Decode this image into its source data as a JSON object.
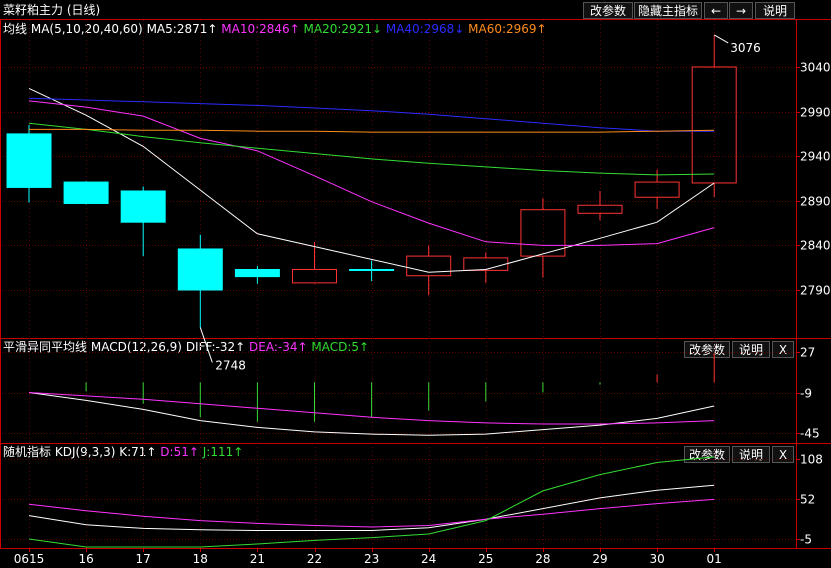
{
  "title_bar": {
    "name": "菜籽粕主力 (日线)",
    "buttons": [
      "改参数",
      "隐藏主指标",
      "←",
      "→",
      "说明"
    ]
  },
  "panels": {
    "ma": {
      "label": "均线",
      "params": "MA(5,10,20,40,60)",
      "items": [
        {
          "text": "MA5:2871↑",
          "color": "#ffffff"
        },
        {
          "text": "MA10:2846↑",
          "color": "#ff33ff"
        },
        {
          "text": "MA20:2921↓",
          "color": "#33dd33"
        },
        {
          "text": "MA40:2968↓",
          "color": "#2b2bff"
        },
        {
          "text": "MA60:2969↑",
          "color": "#ff8c1a"
        }
      ],
      "y_ticks": [
        "3040",
        "2990",
        "2940",
        "2890",
        "2840",
        "2790"
      ],
      "annotations": {
        "high": "3076",
        "low": "2748"
      }
    },
    "macd": {
      "label": "平滑异同平均线",
      "params": "MACD(12,26,9)",
      "items": [
        {
          "text": "DIFF:-32↑",
          "color": "#ffffff"
        },
        {
          "text": "DEA:-34↑",
          "color": "#ff33ff"
        },
        {
          "text": "MACD:5↑",
          "color": "#33dd33"
        }
      ],
      "buttons": [
        "改参数",
        "说明",
        "X"
      ],
      "y_ticks": [
        "27",
        "-9",
        "-45"
      ]
    },
    "kdj": {
      "label": "随机指标",
      "params": "KDJ(9,3,3)",
      "items": [
        {
          "text": "K:71↑",
          "color": "#ffffff"
        },
        {
          "text": "D:51↑",
          "color": "#ff33ff"
        },
        {
          "text": "J:111↑",
          "color": "#33dd33"
        }
      ],
      "buttons": [
        "改参数",
        "说明",
        "X"
      ],
      "y_ticks": [
        "108",
        "52",
        "-5"
      ]
    }
  },
  "x_labels": [
    "0615",
    "16",
    "17",
    "18",
    "21",
    "22",
    "23",
    "24",
    "25",
    "28",
    "29",
    "30",
    "01"
  ],
  "colors": {
    "up": "#ff3333",
    "down": "#00ffff",
    "axis": "#cc0000",
    "grid": "#5a0000"
  },
  "chart_data": [
    {
      "type": "candlestick",
      "categories": [
        "0615",
        "16",
        "17",
        "18",
        "21",
        "22",
        "23",
        "24",
        "25",
        "28",
        "29",
        "30",
        "01"
      ],
      "candles": [
        {
          "open": 2965,
          "high": 2975,
          "low": 2888,
          "close": 2905
        },
        {
          "open": 2911,
          "high": 2912,
          "low": 2886,
          "close": 2887
        },
        {
          "open": 2901,
          "high": 2906,
          "low": 2828,
          "close": 2866
        },
        {
          "open": 2836,
          "high": 2852,
          "low": 2748,
          "close": 2790
        },
        {
          "open": 2813,
          "high": 2817,
          "low": 2797,
          "close": 2805
        },
        {
          "open": 2798,
          "high": 2844,
          "low": 2797,
          "close": 2813
        },
        {
          "open": 2813,
          "high": 2823,
          "low": 2800,
          "close": 2812
        },
        {
          "open": 2806,
          "high": 2840,
          "low": 2784,
          "close": 2828
        },
        {
          "open": 2812,
          "high": 2832,
          "low": 2798,
          "close": 2826
        },
        {
          "open": 2828,
          "high": 2893,
          "low": 2804,
          "close": 2880
        },
        {
          "open": 2876,
          "high": 2901,
          "low": 2868,
          "close": 2885
        },
        {
          "open": 2894,
          "high": 2925,
          "low": 2881,
          "close": 2911
        },
        {
          "open": 2910,
          "high": 3076,
          "low": 2894,
          "close": 3040
        }
      ],
      "series": [
        {
          "name": "MA5",
          "values": [
            3016,
            2986,
            2951,
            null,
            2853,
            null,
            null,
            2810,
            2813,
            null,
            2848,
            2866,
            2910
          ]
        },
        {
          "name": "MA10",
          "values": [
            3002,
            2995,
            2985,
            2960,
            2946,
            2918,
            2889,
            2865,
            2844,
            2840,
            2840,
            2842,
            2860
          ]
        },
        {
          "name": "MA20",
          "values": [
            2977,
            2970,
            2962,
            2955,
            2949,
            2943,
            2937,
            2932,
            2928,
            2924,
            2921,
            2919,
            2920
          ]
        },
        {
          "name": "MA40",
          "values": [
            3005,
            3003,
            3001,
            2999,
            2997,
            2994,
            2991,
            2987,
            2982,
            2977,
            2972,
            2968,
            2968
          ]
        },
        {
          "name": "MA60",
          "values": [
            2970,
            2970,
            2969,
            2969,
            2968,
            2968,
            2967,
            2967,
            2967,
            2967,
            2967,
            2968,
            2969
          ]
        }
      ],
      "ylim": [
        2748,
        3076
      ]
    },
    {
      "type": "bar",
      "title": "MACD(12,26,9)",
      "categories": [
        "0615",
        "16",
        "17",
        "18",
        "21",
        "22",
        "23",
        "24",
        "25",
        "28",
        "29",
        "30",
        "01"
      ],
      "series": [
        {
          "name": "DIFF",
          "values": [
            -9,
            -16,
            -24,
            -34,
            -40,
            -44,
            -46,
            -47,
            -46,
            -42,
            -38,
            -32,
            -21
          ]
        },
        {
          "name": "DEA",
          "values": [
            -9,
            -12,
            -15,
            -19,
            -23,
            -27,
            -31,
            -34,
            -36,
            -37,
            -37,
            -36,
            -34
          ]
        },
        {
          "name": "MACD",
          "values": [
            0,
            -8,
            -19,
            -31,
            -35,
            -35,
            -31,
            -25,
            -17,
            -9,
            -2,
            7,
            26
          ]
        }
      ],
      "ylim": [
        -45,
        27
      ]
    },
    {
      "type": "line",
      "title": "KDJ(9,3,3)",
      "categories": [
        "0615",
        "16",
        "17",
        "18",
        "21",
        "22",
        "23",
        "24",
        "25",
        "28",
        "29",
        "30",
        "01"
      ],
      "series": [
        {
          "name": "K",
          "values": [
            28,
            15,
            10,
            8,
            7,
            7,
            7,
            11,
            23,
            38,
            53,
            64,
            71
          ]
        },
        {
          "name": "D",
          "values": [
            44,
            35,
            27,
            21,
            17,
            14,
            12,
            14,
            23,
            30,
            38,
            45,
            51
          ]
        },
        {
          "name": "J",
          "values": [
            -5,
            -25,
            -23,
            -18,
            -12,
            -7,
            -3,
            2,
            21,
            63,
            86,
            103,
            111
          ]
        }
      ],
      "ylim": [
        -5,
        108
      ]
    }
  ]
}
